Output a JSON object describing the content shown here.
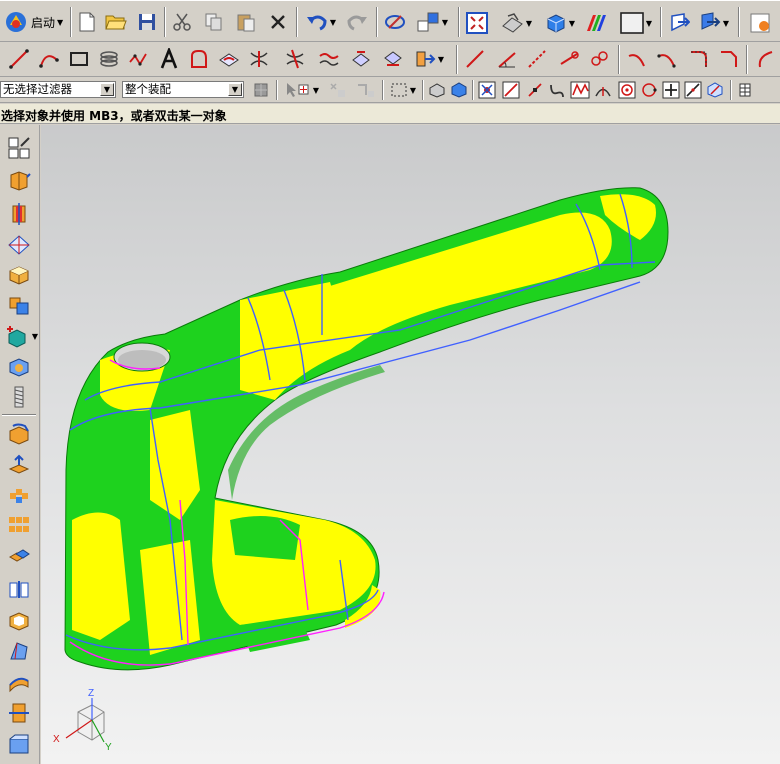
{
  "toolbar": {
    "start_label": "启动",
    "selection_filter": {
      "value": "无选择过滤器"
    },
    "selection_scope": {
      "value": "整个装配"
    }
  },
  "status": {
    "prompt": "选择对象并使用 MB3，或者双击某一对象"
  },
  "triad": {
    "z_label": "Z",
    "x_label": "X",
    "y_label": "Y"
  },
  "model": {
    "colors": {
      "green": "#1ed21e",
      "yellow": "#ffff00",
      "boundary_blue": "#4060ff",
      "boundary_magenta": "#ff20ff"
    }
  }
}
